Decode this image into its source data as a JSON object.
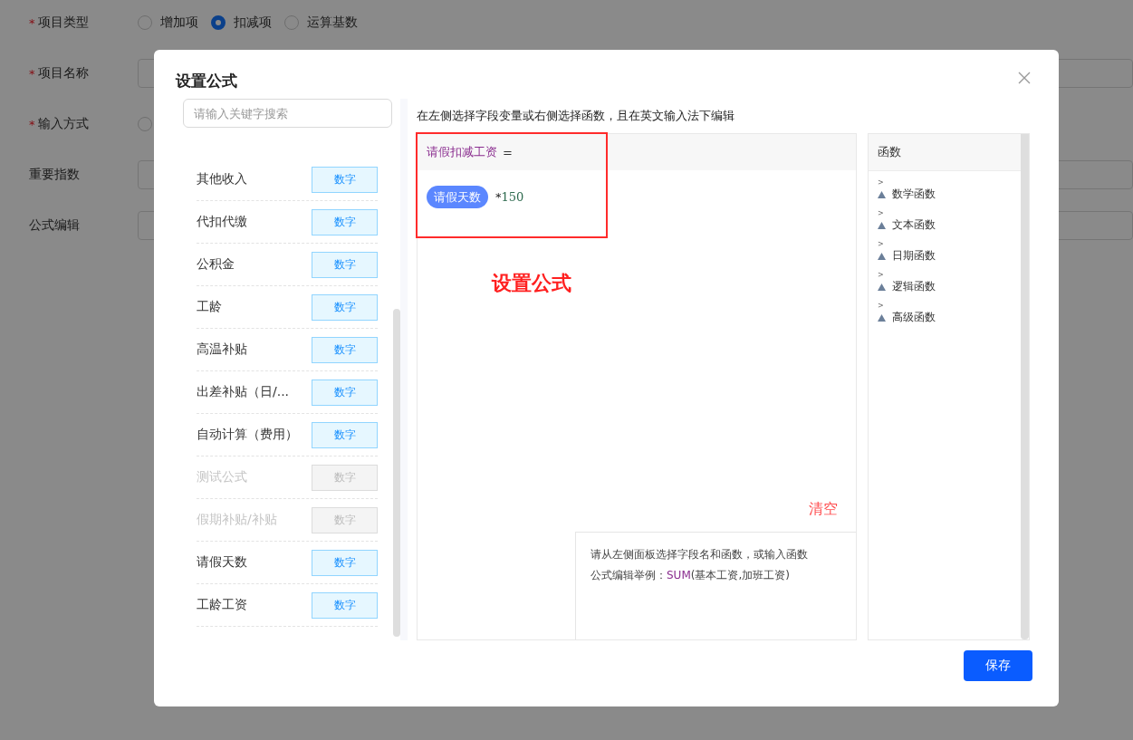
{
  "background_form": {
    "fields": [
      {
        "kind": "radio",
        "label": "项目类型",
        "required_mark": "*",
        "options": [
          {
            "label": "增加项",
            "selected": false
          },
          {
            "label": "扣减项",
            "selected": true
          },
          {
            "label": "运算基数",
            "selected": false
          }
        ]
      },
      {
        "kind": "input",
        "label": "项目名称",
        "required_mark": "*"
      },
      {
        "kind": "radio",
        "label": "输入方式",
        "required_mark": "*",
        "options": [
          {
            "selected": false
          }
        ]
      },
      {
        "kind": "input",
        "label": "重要指数"
      },
      {
        "kind": "input",
        "label": "公式编辑"
      }
    ]
  },
  "dialog": {
    "title": "设置公式",
    "search": {
      "placeholder": "请输入关键字搜索"
    },
    "fields": [
      {
        "name": "其他收入",
        "tag": "数字",
        "disabled": false
      },
      {
        "name": "代扣代缴",
        "tag": "数字",
        "disabled": false
      },
      {
        "name": "公积金",
        "tag": "数字",
        "disabled": false
      },
      {
        "name": "工龄",
        "tag": "数字",
        "disabled": false
      },
      {
        "name": "高温补贴",
        "tag": "数字",
        "disabled": false
      },
      {
        "name": "出差补贴（日/...",
        "tag": "数字",
        "disabled": false
      },
      {
        "name": "自动计算（费用）",
        "tag": "数字",
        "disabled": false
      },
      {
        "name": "测试公式",
        "tag": "数字",
        "disabled": true
      },
      {
        "name": "假期补贴/补贴",
        "tag": "数字",
        "disabled": true
      },
      {
        "name": "请假天数",
        "tag": "数字",
        "disabled": false
      },
      {
        "name": "工龄工资",
        "tag": "数字",
        "disabled": false
      }
    ],
    "instruction": "在左侧选择字段变量或右侧选择函数，且在英文输入法下编辑",
    "formula": {
      "target": "请假扣减工资",
      "equals": "=",
      "tokens": [
        {
          "kind": "field",
          "text": "请假天数"
        },
        {
          "kind": "operator",
          "text": "*"
        },
        {
          "kind": "number",
          "text": "150"
        }
      ]
    },
    "annotation": "设置公式",
    "clear_button": "清空",
    "hint": {
      "line_1": "请从左侧面板选择字段名和函数，或输入函数",
      "line_2": {
        "prefix": "公式编辑举例：",
        "function": "SUM",
        "args": "(基本工资,加班工资)"
      }
    },
    "functions": {
      "title": "函数",
      "groups": [
        {
          "marker": ">",
          "label": "数学函数"
        },
        {
          "marker": ">",
          "label": "文本函数"
        },
        {
          "marker": ">",
          "label": "日期函数"
        },
        {
          "marker": ">",
          "label": "逻辑函数"
        },
        {
          "marker": ">",
          "label": "高级函数"
        }
      ]
    },
    "save_button": "保存"
  }
}
